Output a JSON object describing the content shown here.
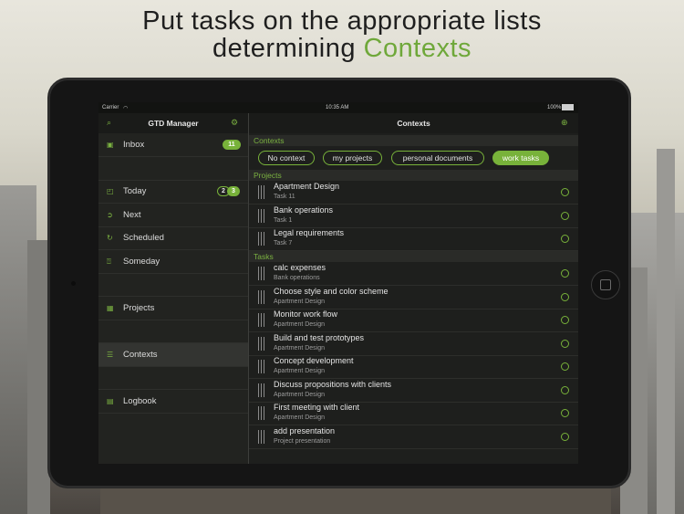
{
  "headline": {
    "line1": "Put tasks on the appropriate lists",
    "line2_prefix": "determining ",
    "line2_accent": "Contexts"
  },
  "colors": {
    "accent": "#78b23a",
    "background": "#1e1f1d"
  },
  "statusbar": {
    "carrier": "Carrier",
    "time": "10:35 AM",
    "battery": "100%"
  },
  "sidebar": {
    "title": "GTD Manager",
    "search_icon": "search-icon",
    "settings_icon": "gear-icon",
    "items": [
      {
        "label": "Inbox",
        "icon": "inbox-icon",
        "badge": "11"
      },
      {
        "label": "Today",
        "icon": "calendar-icon",
        "badge_a": "2",
        "badge_b": "3"
      },
      {
        "label": "Next",
        "icon": "arrow-icon"
      },
      {
        "label": "Scheduled",
        "icon": "repeat-icon"
      },
      {
        "label": "Someday",
        "icon": "question-icon"
      },
      {
        "label": "Projects",
        "icon": "projects-icon"
      },
      {
        "label": "Contexts",
        "icon": "contexts-icon"
      },
      {
        "label": "Logbook",
        "icon": "logbook-icon"
      }
    ]
  },
  "main": {
    "title": "Contexts",
    "add_icon": "add-icon",
    "contexts_header": "Contexts",
    "chips": [
      "No context",
      "my projects",
      "personal documents",
      "work tasks"
    ],
    "selected_chip": "work tasks",
    "projects_header": "Projects",
    "projects": [
      {
        "title": "Apartment Design",
        "sub": "Task 11"
      },
      {
        "title": "Bank operations",
        "sub": "Task 1"
      },
      {
        "title": "Legal requirements",
        "sub": "Task 7"
      }
    ],
    "tasks_header": "Tasks",
    "tasks": [
      {
        "title": "calc expenses",
        "sub": "Bank operations"
      },
      {
        "title": "Choose style and color scheme",
        "sub": "Apartment Design"
      },
      {
        "title": "Monitor work flow",
        "sub": "Apartment Design"
      },
      {
        "title": "Build and test prototypes",
        "sub": "Apartment Design"
      },
      {
        "title": "Concept development",
        "sub": "Apartment Design"
      },
      {
        "title": "Discuss propositions with clients",
        "sub": "Apartment Design"
      },
      {
        "title": "First meeting with client",
        "sub": "Apartment Design"
      },
      {
        "title": "add presentation",
        "sub": "Project presentation"
      }
    ]
  }
}
